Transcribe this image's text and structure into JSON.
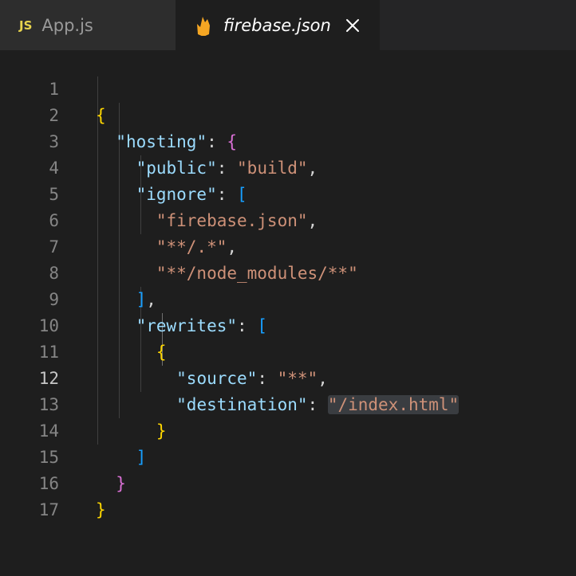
{
  "tabs": [
    {
      "label": "App.js",
      "icon": "js-icon",
      "icon_text": "JS",
      "active": false
    },
    {
      "label": "firebase.json",
      "icon": "firebase-flame-icon",
      "active": true,
      "close_glyph": "✕"
    }
  ],
  "colors": {
    "brace_level1": "#ffd700",
    "brace_level2": "#da70d6",
    "bracket_level3": "#179fff",
    "key": "#9cdcfe",
    "string": "#ce9178"
  },
  "editor": {
    "active_line": 12,
    "lines": [
      {
        "n": "1"
      },
      {
        "n": "2"
      },
      {
        "n": "3"
      },
      {
        "n": "4"
      },
      {
        "n": "5"
      },
      {
        "n": "6"
      },
      {
        "n": "7"
      },
      {
        "n": "8"
      },
      {
        "n": "9"
      },
      {
        "n": "10"
      },
      {
        "n": "11"
      },
      {
        "n": "12"
      },
      {
        "n": "13"
      },
      {
        "n": "14"
      },
      {
        "n": "15"
      },
      {
        "n": "16"
      },
      {
        "n": "17"
      }
    ],
    "code": {
      "l1_brace": "{",
      "l2_key": "\"hosting\"",
      "l2_colon": ": ",
      "l2_brace": "{",
      "l3_key": "\"public\"",
      "l3_colon": ": ",
      "l3_value": "\"build\"",
      "l3_comma": ",",
      "l4_key": "\"ignore\"",
      "l4_colon": ": ",
      "l4_bracket": "[",
      "l5_value": "\"firebase.json\"",
      "l5_comma": ",",
      "l6_value": "\"**/.*\"",
      "l6_comma": ",",
      "l7_value": "\"**/node_modules/**\"",
      "l8_bracket": "]",
      "l8_comma": ",",
      "l9_key": "\"rewrites\"",
      "l9_colon": ": ",
      "l9_bracket": "[",
      "l10_brace": "{",
      "l11_key": "\"source\"",
      "l11_colon": ": ",
      "l11_value": "\"**\"",
      "l11_comma": ",",
      "l12_key": "\"destination\"",
      "l12_colon": ": ",
      "l12_value": "\"/index.html\"",
      "l13_brace": "}",
      "l14_bracket": "]",
      "l15_brace": "}",
      "l16_brace": "}"
    }
  }
}
